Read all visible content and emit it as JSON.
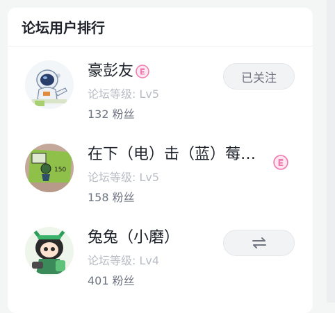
{
  "panel": {
    "title": "论坛用户排行"
  },
  "users": [
    {
      "name": "豪彭友",
      "level": "论坛等级: Lv5",
      "fans": "132 粉丝",
      "action": "已关注",
      "action_type": "followed"
    },
    {
      "name": "在下（电）击（蓝）莓…",
      "level": "论坛等级: Lv5",
      "fans": "158 粉丝",
      "action": "",
      "action_type": "none"
    },
    {
      "name": "兔兔（小磨）",
      "level": "论坛等级: Lv4",
      "fans": "401 粉丝",
      "action": "",
      "action_type": "mutual"
    }
  ],
  "icons": {
    "badge": "creator-badge-icon",
    "mutual": "mutual-follow-icon"
  },
  "colors": {
    "badge_pink": "#f07ab0",
    "text_primary": "#1d2129",
    "text_muted": "#b8bcc4"
  }
}
